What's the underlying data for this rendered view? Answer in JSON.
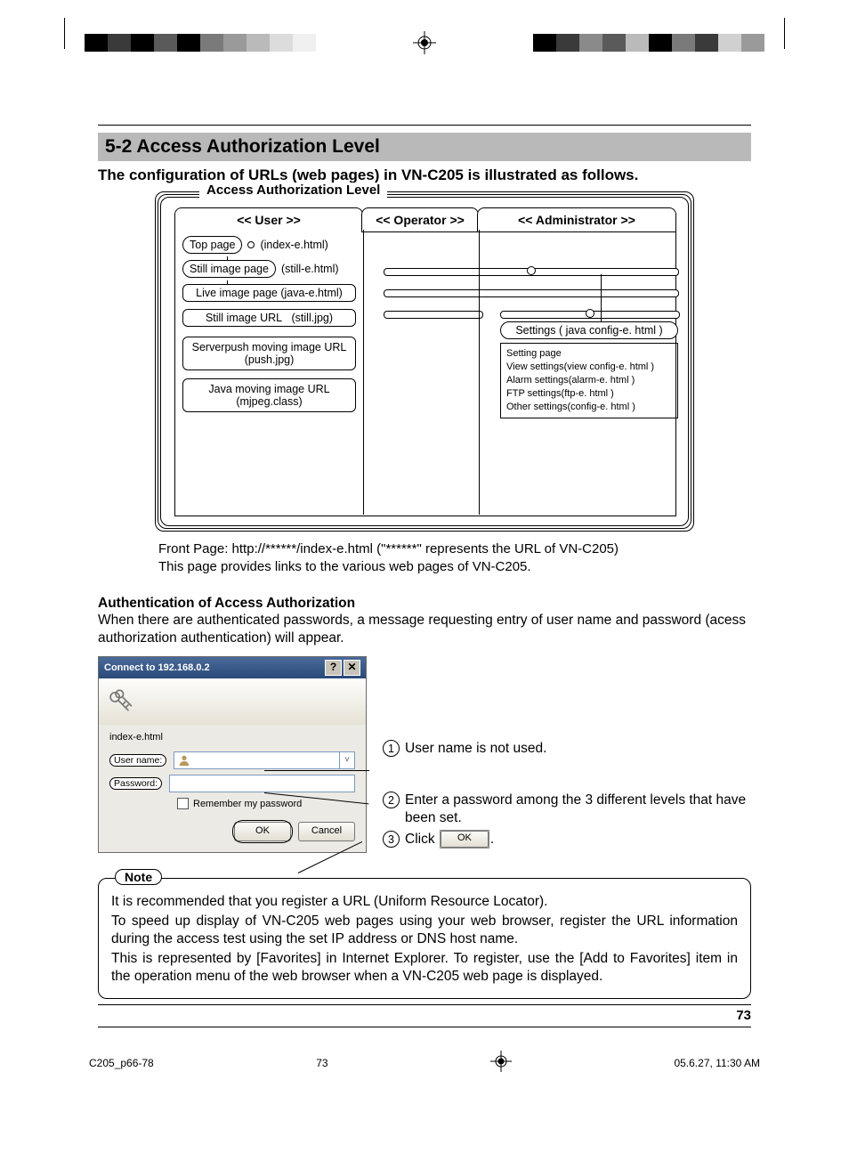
{
  "section_header": "5-2 Access Authorization Level",
  "intro": "The configuration of URLs (web pages) in VN-C205 is illustrated as follows.",
  "diagram": {
    "title": "Access Authorization Level",
    "tabs": {
      "user": "<< User >>",
      "operator": "<< Operator >>",
      "admin": "<< Administrator >>"
    },
    "user_items": {
      "top_page": "Top page",
      "top_page_url": "(index-e.html)",
      "still_page": "Still image page",
      "still_page_url": "(still-e.html)",
      "live_page": "Live image page (java-e.html)",
      "still_url": "Still image URL",
      "still_url_file": "(still.jpg)",
      "push": "Serverpush moving image URL\n(push.jpg)",
      "java": "Java moving image URL\n(mjpeg.class)"
    },
    "admin": {
      "settings": "Settings ( java config-e. html )",
      "list": [
        "Setting page",
        "View settings(view config-e. html )",
        "Alarm settings(alarm-e. html )",
        "FTP settings(ftp-e. html )",
        "Other settings(config-e. html )"
      ]
    }
  },
  "front_page": {
    "l1": "Front Page: http://******/index-e.html (\"******\" represents the URL of VN-C205)",
    "l2": "This page provides links to the various web pages of VN-C205."
  },
  "auth": {
    "head": "Authentication of Access Authorization",
    "body": "When there are authenticated passwords, a message requesting entry of user name and password (acess authorization authentication) will appear."
  },
  "dialog": {
    "title": "Connect to 192.168.0.2",
    "help_icon": "?",
    "close_icon": "✕",
    "realm": "index-e.html",
    "user_label": "User name:",
    "pass_label": "Password:",
    "user_value": "",
    "dropdown_icon": "˅",
    "remember": "Remember my password",
    "ok": "OK",
    "cancel": "Cancel"
  },
  "annot": {
    "a1": "User name is not used.",
    "a2": "Enter a password among the 3 different levels that have been set.",
    "a3_pre": "Click",
    "a3_btn": "OK",
    "a3_post": "."
  },
  "note": {
    "label": "Note",
    "p1": "It is recommended that you register a URL (Uniform Resource Locator).",
    "p2": "To speed up display of VN-C205 web pages using your web browser, register the URL information during the access test using the set IP address or DNS host name.",
    "p3": "This is represented by [Favorites] in Internet Explorer. To register, use the [Add to Favorites] item in the operation menu of the web browser when a VN-C205 web page is displayed."
  },
  "page_number": "73",
  "footer": {
    "left": "C205_p66-78",
    "center": "73",
    "right": "05.6.27, 11:30 AM"
  }
}
